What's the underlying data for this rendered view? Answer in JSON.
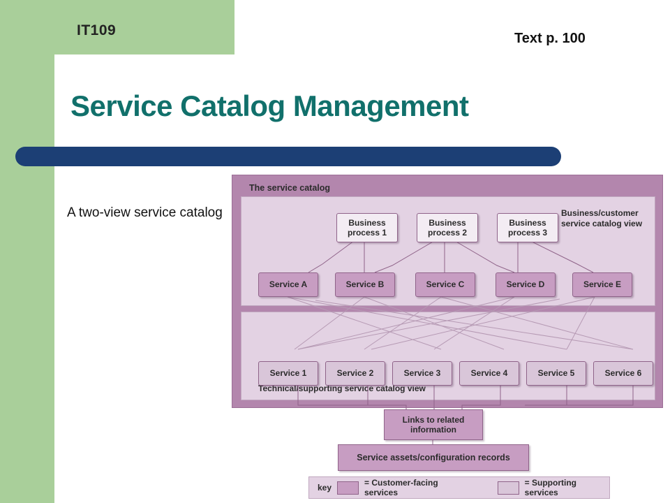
{
  "slide": {
    "course_code": "IT109",
    "text_reference": "Text p. 100",
    "title": "Service Catalog Management",
    "caption": "A two-view service catalog",
    "accent_title_color": "#11706b",
    "accent_bar_color": "#1c3f75",
    "accent_green_color": "#a9cf9a"
  },
  "figure": {
    "outer_label": "The service catalog",
    "view_top_label": "Business/customer service catalog view",
    "view_bottom_label": "Technical/supporting service catalog view",
    "business_processes": [
      {
        "label": "Business process 1"
      },
      {
        "label": "Business process 2"
      },
      {
        "label": "Business process 3"
      }
    ],
    "customer_facing_services": [
      {
        "label": "Service A"
      },
      {
        "label": "Service B"
      },
      {
        "label": "Service C"
      },
      {
        "label": "Service D"
      },
      {
        "label": "Service E"
      }
    ],
    "supporting_services": [
      {
        "label": "Service 1"
      },
      {
        "label": "Service 2"
      },
      {
        "label": "Service 3"
      },
      {
        "label": "Service 4"
      },
      {
        "label": "Service 5"
      },
      {
        "label": "Service 6"
      }
    ],
    "links_box": "Links to related information",
    "assets_box": "Service assets/configuration records",
    "key": {
      "label": "key",
      "customer_facing": "= Customer-facing services",
      "supporting": "= Supporting services",
      "customer_facing_color": "#c79dc2",
      "supporting_color": "#d9c6d9"
    }
  }
}
